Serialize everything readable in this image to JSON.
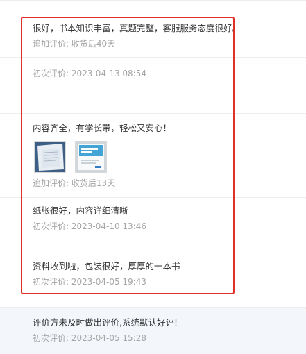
{
  "reviews": [
    {
      "content": "很好，书本知识丰富，真题完整，客服服务态度很好。",
      "followup": "追加评价: 收货后40天",
      "initial": "初次评价: 2023-04-13 08:54"
    },
    {
      "content": "内容齐全，有学长带，轻松又安心！",
      "followup": "追加评价: 收货后13天",
      "images": [
        "book-photo-open-pages",
        "book-photo-cover"
      ]
    },
    {
      "content": "纸张很好，内容详细清晰",
      "initial": "初次评价: 2023-04-10 13:46"
    },
    {
      "content": "资料收到啦，包装很好，厚厚的一本书",
      "initial": "初次评价: 2023-04-05 19:43"
    },
    {
      "content": "评价方未及时做出评价,系统默认好评!",
      "initial": "初次评价: 2023-04-05 15:28"
    }
  ],
  "colors": {
    "highlight_border": "#e0302a",
    "meta_text": "#a6a6a6",
    "body_text": "#333333",
    "band_background": "#f3f6fb"
  }
}
